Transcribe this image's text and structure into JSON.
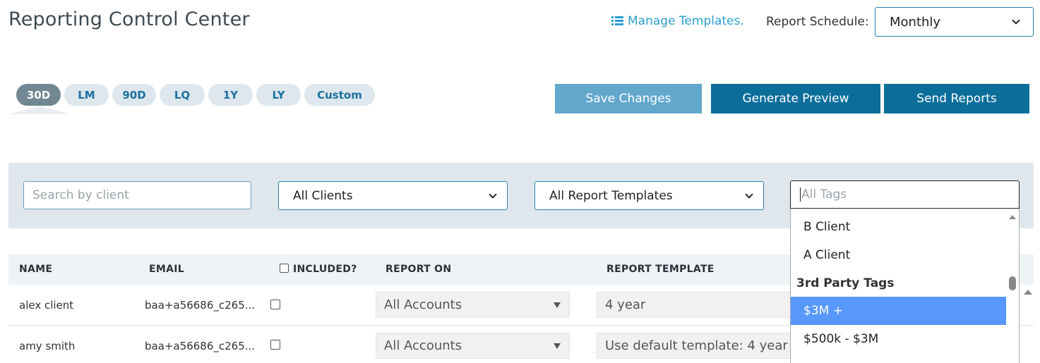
{
  "header": {
    "title": "Reporting Control Center",
    "manage_templates": "Manage Templates.",
    "manage_icon": "list-icon",
    "schedule_label": "Report Schedule:",
    "schedule_value": "Monthly"
  },
  "period_tabs": [
    "30D",
    "LM",
    "90D",
    "LQ",
    "1Y",
    "LY",
    "Custom"
  ],
  "period_active": "30D",
  "actions": {
    "save": "Save Changes",
    "preview": "Generate Preview",
    "send": "Send Reports"
  },
  "filters": {
    "search_placeholder": "Search by client",
    "clients": "All Clients",
    "templates": "All Report Templates",
    "tags_placeholder": "All Tags"
  },
  "table": {
    "headers": [
      "NAME",
      "EMAIL",
      "INCLUDED?",
      "REPORT ON",
      "REPORT TEMPLATE"
    ],
    "rows": [
      {
        "name": "alex client",
        "email": "baa+a56686_c265...",
        "included": false,
        "report_on": "All Accounts",
        "template": "4 year"
      },
      {
        "name": "amy smith",
        "email": "baa+a56686_c265...",
        "included": false,
        "report_on": "All Accounts",
        "template": "Use default template: 4 year"
      }
    ]
  },
  "tags_dropdown": {
    "items": [
      {
        "label": "B Client",
        "type": "option"
      },
      {
        "label": "A Client",
        "type": "option"
      },
      {
        "label": "3rd Party Tags",
        "type": "group"
      },
      {
        "label": "$3M +",
        "type": "option",
        "highlighted": true
      },
      {
        "label": "$500k - $3M",
        "type": "option"
      }
    ]
  },
  "colors": {
    "primary": "#0b6e9a",
    "save_button": "#62a8cc",
    "active_tab": "#718892",
    "link": "#2b9fd0",
    "highlight": "#5897fb"
  }
}
